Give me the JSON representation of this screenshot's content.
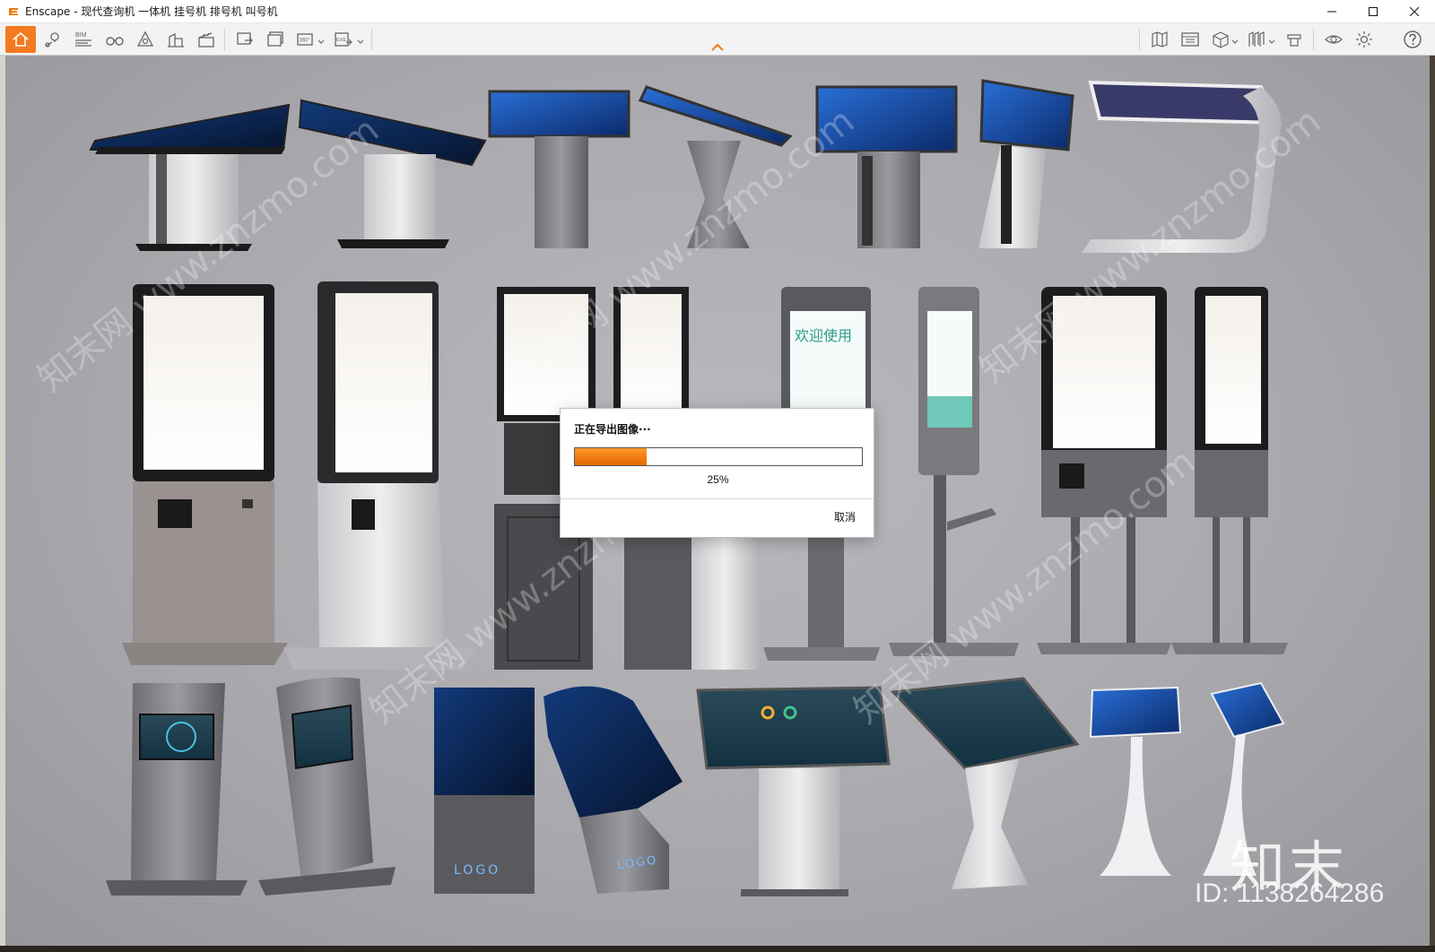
{
  "window": {
    "title": "Enscape - 现代查询机 一体机 挂号机 排号机 叫号机"
  },
  "toolbar": {
    "left_tools": [
      "home-icon",
      "location-pin-icon",
      "bim-icon",
      "binoculars-icon",
      "perspective-icon",
      "building-icon",
      "clapperboard-icon",
      "screenshot-icon",
      "batch-render-icon",
      "panorama-360-icon",
      "exe-export-icon"
    ],
    "right_tools": [
      "map-icon",
      "asset-library-icon",
      "cube-view-icon",
      "view-presets-icon",
      "material-icon",
      "eye-visibility-icon",
      "settings-icon",
      "help-icon"
    ],
    "bim_label": "BIM",
    "pano_label": "360°",
    "exe_label": "EXE"
  },
  "export_dialog": {
    "title": "正在导出图像···",
    "progress": 0.25,
    "progress_text": "25%",
    "cancel_label": "取消",
    "accent": "#f07a10"
  },
  "overlay": {
    "brand": "知末",
    "id_text": "ID: 1138264286",
    "watermark_text": "知末网 www.znzmo.com"
  },
  "render": {
    "kiosk_logo_text": "LOGO",
    "welcome_text": "欢迎使用"
  }
}
